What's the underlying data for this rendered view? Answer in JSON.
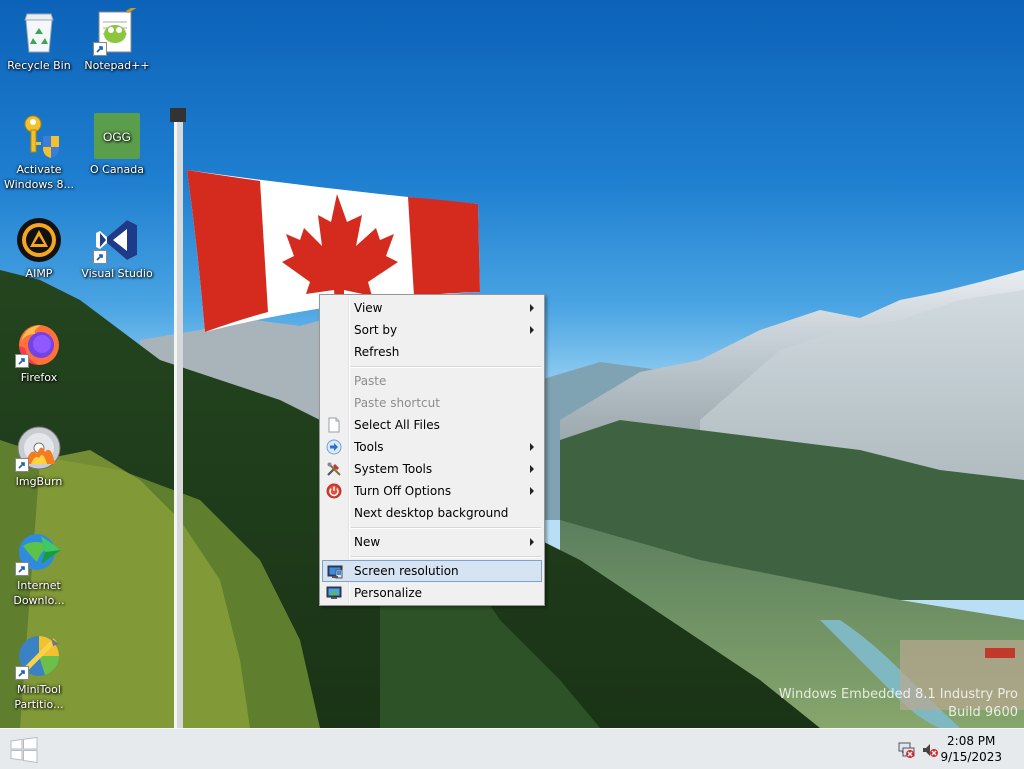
{
  "desktop": {
    "icons": [
      {
        "label": "Recycle Bin",
        "icon": "recycle-bin-icon"
      },
      {
        "label": "Notepad++",
        "icon": "notepad-plus-plus-icon"
      },
      {
        "label": "Activate Windows 8...",
        "icon": "key-shield-icon"
      },
      {
        "label": "O Canada",
        "icon": "ogg-file-icon",
        "badge": "OGG"
      },
      {
        "label": "AIMP",
        "icon": "aimp-icon"
      },
      {
        "label": "Visual Studio",
        "icon": "visual-studio-icon"
      },
      {
        "label": "Firefox",
        "icon": "firefox-icon"
      },
      {
        "label": "ImgBurn",
        "icon": "imgburn-icon"
      },
      {
        "label": "Internet Downlo...",
        "icon": "internet-download-manager-icon"
      },
      {
        "label": "MiniTool Partitio...",
        "icon": "minitool-partition-icon"
      }
    ]
  },
  "context_menu": {
    "items": [
      {
        "label": "View",
        "submenu": true
      },
      {
        "label": "Sort by",
        "submenu": true
      },
      {
        "label": "Refresh"
      },
      {
        "label": "Paste",
        "disabled": true
      },
      {
        "label": "Paste shortcut",
        "disabled": true
      },
      {
        "label": "Select All Files",
        "icon": "document-icon"
      },
      {
        "label": "Tools",
        "submenu": true,
        "icon": "arrow-right-icon"
      },
      {
        "label": "System Tools",
        "submenu": true,
        "icon": "tools-icon"
      },
      {
        "label": "Turn Off Options",
        "submenu": true,
        "icon": "power-icon"
      },
      {
        "label": "Next desktop background"
      },
      {
        "label": "New",
        "submenu": true
      },
      {
        "label": "Screen resolution",
        "icon": "screen-resolution-icon",
        "highlighted": true
      },
      {
        "label": "Personalize",
        "icon": "personalize-icon"
      }
    ]
  },
  "watermark": {
    "line1": "Windows Embedded 8.1 Industry Pro",
    "line2": "Build 9600"
  },
  "taskbar": {
    "time": "2:08 PM",
    "date": "9/15/2023",
    "tray_icons": [
      "network-disconnected-icon",
      "volume-muted-icon"
    ]
  },
  "colors": {
    "menu_highlight": "#d5e3f3",
    "menu_highlight_border": "#7da2ce",
    "flag_red": "#d52b1e"
  }
}
